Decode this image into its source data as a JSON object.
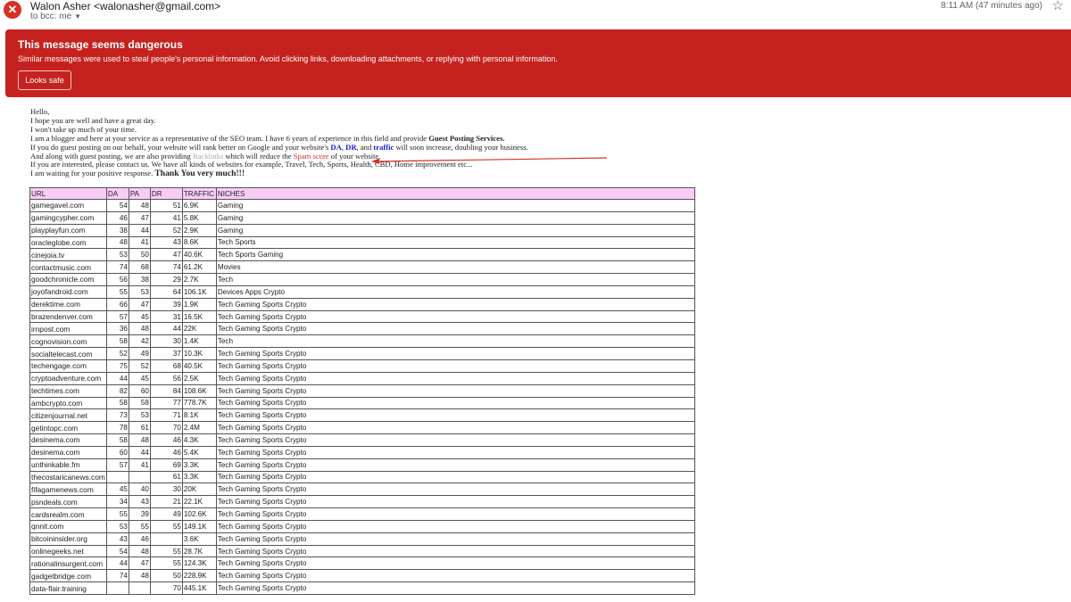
{
  "header": {
    "sender_name": "Walon Asher",
    "sender_email": "<walonasher@gmail.com>",
    "to_line": "to bcc: me",
    "time": "8:11 AM (47 minutes ago)",
    "alert_icon": "x-icon",
    "star_icon": "star-outline-icon"
  },
  "warning": {
    "title": "This message seems dangerous",
    "text": "Similar messages were used to steal people's personal information. Avoid clicking links, downloading attachments, or replying with personal information.",
    "button_label": "Looks safe",
    "color": "#c5221f"
  },
  "email": {
    "greeting": "Hello,",
    "line1": "I hope you are well and have a great day.",
    "line2": "I won't take up much of your time.",
    "line3_pre": "I am a blogger and here at your service as a representative of the SEO team. I have 6 years of experience in this field and provide ",
    "line3_bold": "Guest Posting Services.",
    "line4_pre": "If you do guest posting on our behalf, your website will rank better on Google and your website's ",
    "line4_da": "DA",
    "line4_sep1": ", ",
    "line4_dr": "DR",
    "line4_and": ", and ",
    "line4_traffic": "traffic",
    "line4_post": " will soon increase, doubling your business.",
    "line5_pre": "And along with guest posting, we are also providing ",
    "line5_backlinks": "Backlinks",
    "line5_mid": " which will reduce the ",
    "line5_spam": "Spam score",
    "line5_post": " of your website.",
    "line6": "If you are interested, please contact us. We have all kinds of websites for example, Travel, Tech, Sports, Health, CBD, Home improvement etc...",
    "line7_pre": "I am waiting for your positive response. ",
    "line7_bold": "Thank You very much!!!"
  },
  "table": {
    "columns": [
      "URL",
      "DA",
      "PA",
      "DR",
      "TRAFFIC",
      "NICHES"
    ],
    "header_color": "#f9ccf8",
    "rows": [
      [
        "gamegavel.com",
        "54",
        "48",
        "51",
        "6.9K",
        "Gaming"
      ],
      [
        "gamingcypher.com",
        "46",
        "47",
        "41",
        "5.8K",
        "Gaming"
      ],
      [
        "playplayfun.com",
        "38",
        "44",
        "52",
        "2.9K",
        "Gaming"
      ],
      [
        "oracleglobe.com",
        "48",
        "41",
        "43",
        "8.6K",
        "Tech Sports"
      ],
      [
        "cinejoia.tv",
        "53",
        "50",
        "47",
        "40.6K",
        "Tech Sports Gaming"
      ],
      [
        "contactmusic.com",
        "74",
        "68",
        "74",
        "61.2K",
        "Movies"
      ],
      [
        "goodchronicle.com",
        "56",
        "38",
        "29",
        "2.7K",
        "Tech"
      ],
      [
        "joyofandroid.com",
        "55",
        "53",
        "64",
        "106.1K",
        "Devices Apps Crypto"
      ],
      [
        "derektime.com",
        "66",
        "47",
        "39",
        "1.9K",
        "Tech Gaming Sports Crypto"
      ],
      [
        "brazendenver.com",
        "57",
        "45",
        "31",
        "16.5K",
        "Tech Gaming Sports Crypto"
      ],
      [
        "irnpost.com",
        "36",
        "48",
        "44",
        "22K",
        "Tech Gaming Sports Crypto"
      ],
      [
        "cognovision.com",
        "58",
        "42",
        "30",
        "1.4K",
        "Tech"
      ],
      [
        "socialtelecast.com",
        "52",
        "49",
        "37",
        "10.3K",
        "Tech Gaming Sports Crypto"
      ],
      [
        "techengage.com",
        "75",
        "52",
        "68",
        "40.5K",
        "Tech Gaming Sports Crypto"
      ],
      [
        "cryptoadventure.com",
        "44",
        "45",
        "56",
        "2.5K",
        "Tech Gaming Sports Crypto"
      ],
      [
        "techtimes.com",
        "82",
        "60",
        "84",
        "108.6K",
        "Tech Gaming Sports Crypto"
      ],
      [
        "ambcrypto.com",
        "58",
        "58",
        "77",
        "778.7K",
        "Tech Gaming Sports Crypto"
      ],
      [
        "citizenjournal.net",
        "73",
        "53",
        "71",
        "8.1K",
        "Tech Gaming Sports Crypto"
      ],
      [
        "getintopc.com",
        "78",
        "61",
        "70",
        "2.4M",
        "Tech Gaming Sports Crypto"
      ],
      [
        "desinema.com",
        "58",
        "48",
        "46",
        "4.3K",
        "Tech Gaming Sports Crypto"
      ],
      [
        "desinema.com",
        "60",
        "44",
        "46",
        "5.4K",
        "Tech Gaming Sports Crypto"
      ],
      [
        "unthinkable.fm",
        "57",
        "41",
        "69",
        "3.3K",
        "Tech Gaming Sports Crypto"
      ],
      [
        "thecostaricanews.com",
        "",
        "",
        "61",
        "3.3K",
        "Tech Gaming Sports Crypto"
      ],
      [
        "fifagamenews.com",
        "45",
        "40",
        "30",
        "20K",
        "Tech Gaming Sports Crypto"
      ],
      [
        "psndeals.com",
        "34",
        "43",
        "21",
        "22.1K",
        "Tech Gaming Sports Crypto"
      ],
      [
        "cardsrealm.com",
        "55",
        "39",
        "49",
        "102.6K",
        "Tech Gaming Sports Crypto"
      ],
      [
        "qnnit.com",
        "53",
        "55",
        "55",
        "149.1K",
        "Tech Gaming Sports Crypto"
      ],
      [
        "bitcoininsider.org",
        "43",
        "46",
        "",
        "3.6K",
        "Tech Gaming Sports Crypto"
      ],
      [
        "onlinegeeks.net",
        "54",
        "48",
        "55",
        "28.7K",
        "Tech Gaming Sports Crypto"
      ],
      [
        "rationalinsurgent.com",
        "44",
        "47",
        "55",
        "124.3K",
        "Tech Gaming Sports Crypto"
      ],
      [
        "gadgetbridge.com",
        "74",
        "48",
        "50",
        "228.9K",
        "Tech Gaming Sports Crypto"
      ],
      [
        "data-flair.training",
        "",
        "",
        "70",
        "445.1K",
        "Tech Gaming Sports Crypto"
      ]
    ]
  }
}
